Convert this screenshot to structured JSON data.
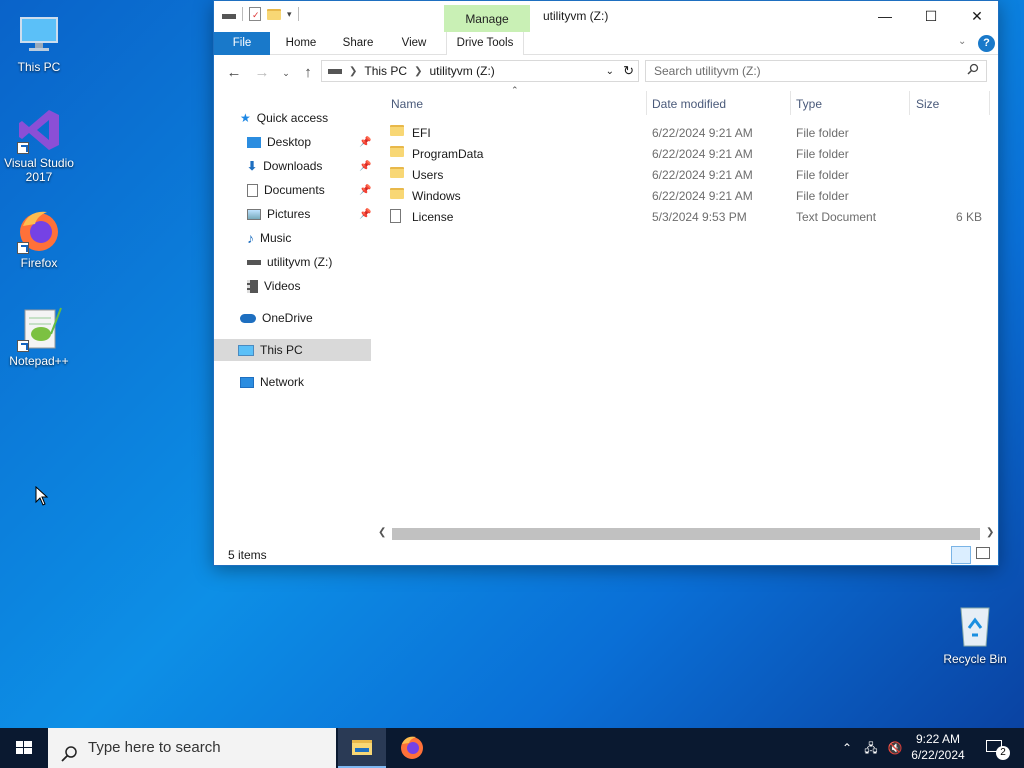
{
  "desktop": {
    "icons": [
      {
        "label": "This PC"
      },
      {
        "label": "Visual Studio 2017"
      },
      {
        "label": "Firefox"
      },
      {
        "label": "Notepad++"
      },
      {
        "label": "Recycle Bin"
      }
    ]
  },
  "window": {
    "title": "utilityvm (Z:)",
    "context_tab": "Manage",
    "controls": {
      "minimize": "—",
      "maximize": "☐",
      "close": "✕"
    },
    "ribbon_tabs": [
      "File",
      "Home",
      "Share",
      "View",
      "Drive Tools"
    ],
    "address": {
      "crumbs": [
        "This PC",
        "utilityvm (Z:)"
      ]
    },
    "search_placeholder": "Search utilityvm (Z:)",
    "nav": {
      "quick_access": "Quick access",
      "items": [
        {
          "label": "Desktop",
          "pinned": true
        },
        {
          "label": "Downloads",
          "pinned": true
        },
        {
          "label": "Documents",
          "pinned": true
        },
        {
          "label": "Pictures",
          "pinned": true
        },
        {
          "label": "Music",
          "pinned": false
        },
        {
          "label": "utilityvm (Z:)",
          "pinned": false
        },
        {
          "label": "Videos",
          "pinned": false
        }
      ],
      "onedrive": "OneDrive",
      "this_pc": "This PC",
      "network": "Network"
    },
    "columns": {
      "name": "Name",
      "date": "Date modified",
      "type": "Type",
      "size": "Size"
    },
    "files": [
      {
        "name": "EFI",
        "date": "6/22/2024 9:21 AM",
        "type": "File folder",
        "size": ""
      },
      {
        "name": "ProgramData",
        "date": "6/22/2024 9:21 AM",
        "type": "File folder",
        "size": ""
      },
      {
        "name": "Users",
        "date": "6/22/2024 9:21 AM",
        "type": "File folder",
        "size": ""
      },
      {
        "name": "Windows",
        "date": "6/22/2024 9:21 AM",
        "type": "File folder",
        "size": ""
      },
      {
        "name": "License",
        "date": "5/3/2024 9:53 PM",
        "type": "Text Document",
        "size": "6 KB"
      }
    ],
    "status": "5 items"
  },
  "taskbar": {
    "search_placeholder": "Type here to search",
    "time": "9:22 AM",
    "date": "6/22/2024",
    "notification_count": "2"
  },
  "colors": {
    "accent": "#1979ca",
    "manage_tab": "#c9f0b5",
    "taskbar": "#0a1930"
  }
}
